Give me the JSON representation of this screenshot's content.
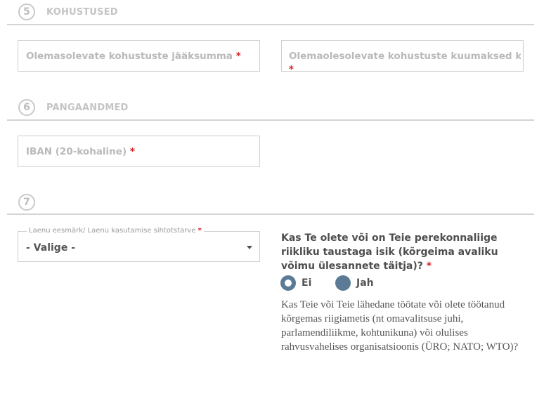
{
  "section5": {
    "number": "5",
    "title": "KOHUSTUSED"
  },
  "fields5": {
    "remaining_label": "Olemasolevate kohustuste jääksumma",
    "monthly_label": "Olemaolesolevate kohustuste kuumaksed kokku",
    "required_mark": "*"
  },
  "section6": {
    "number": "6",
    "title": "PANGAANDMED"
  },
  "fields6": {
    "iban_label": "IBAN (20-kohaline)",
    "required_mark": "*"
  },
  "section7": {
    "number": "7"
  },
  "purpose_select": {
    "legend": "Laenu eesmärk/ Laenu kasutamise sihtotstarve",
    "required_mark": "*",
    "value": "- Valige -"
  },
  "pep_question": {
    "text": "Kas Te olete või on Teie perekonnaliige riikliku taustaga isik (kõrgeima avaliku võimu ülesannete täitja)?",
    "required_mark": "*",
    "options": [
      {
        "label": "Ei",
        "selected": true
      },
      {
        "label": "Jah",
        "selected": false
      }
    ],
    "help": "Kas Teie või Teie lähedane töötate või olete töötanud kõrgemas riigiametis (nt omavalitsuse juhi, parlamendiliikme, kohtunikuna) või olulises rahvusvahelises organisatsioonis (ÜRO; NATO; WTO)?"
  },
  "colors": {
    "accent": "#5a7a96",
    "required": "#d61f1f",
    "muted": "#c4c4c4"
  }
}
